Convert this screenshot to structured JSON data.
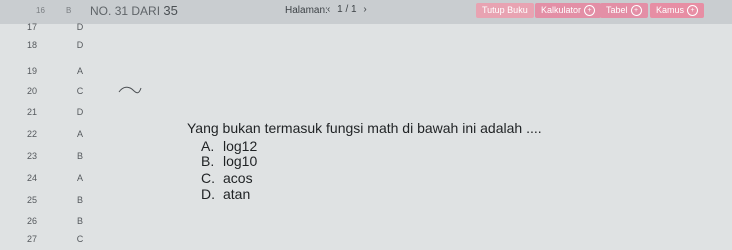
{
  "header": {
    "num_col": "16",
    "key_col": "B",
    "soal_prefix": "NO.",
    "soal_no": "31",
    "soal_mid": "DARI",
    "soal_total": "35",
    "page_label": "Halaman:",
    "prev": "‹",
    "page_value": "1 / 1",
    "next": "›"
  },
  "buttons": [
    {
      "label": "Tutup Buku"
    },
    {
      "label": "Kalkulator"
    },
    {
      "label": "Tabel"
    },
    {
      "label": "Kamus"
    }
  ],
  "answers": [
    {
      "num": "17",
      "key": "D"
    },
    {
      "num": "18",
      "key": "D"
    },
    {
      "num": "19",
      "key": "A"
    },
    {
      "num": "20",
      "key": "C"
    },
    {
      "num": "21",
      "key": "D"
    },
    {
      "num": "22",
      "key": "A"
    },
    {
      "num": "23",
      "key": "B"
    },
    {
      "num": "24",
      "key": "A"
    },
    {
      "num": "25",
      "key": "B"
    },
    {
      "num": "26",
      "key": "B"
    },
    {
      "num": "27",
      "key": "C"
    }
  ],
  "question": {
    "text": "Yang bukan termasuk fungsi math di bawah ini adalah ....",
    "options": [
      {
        "letter": "A.",
        "text": "log12"
      },
      {
        "letter": "B.",
        "text": "log10"
      },
      {
        "letter": "C.",
        "text": "acos"
      },
      {
        "letter": "D.",
        "text": "atan"
      }
    ]
  }
}
